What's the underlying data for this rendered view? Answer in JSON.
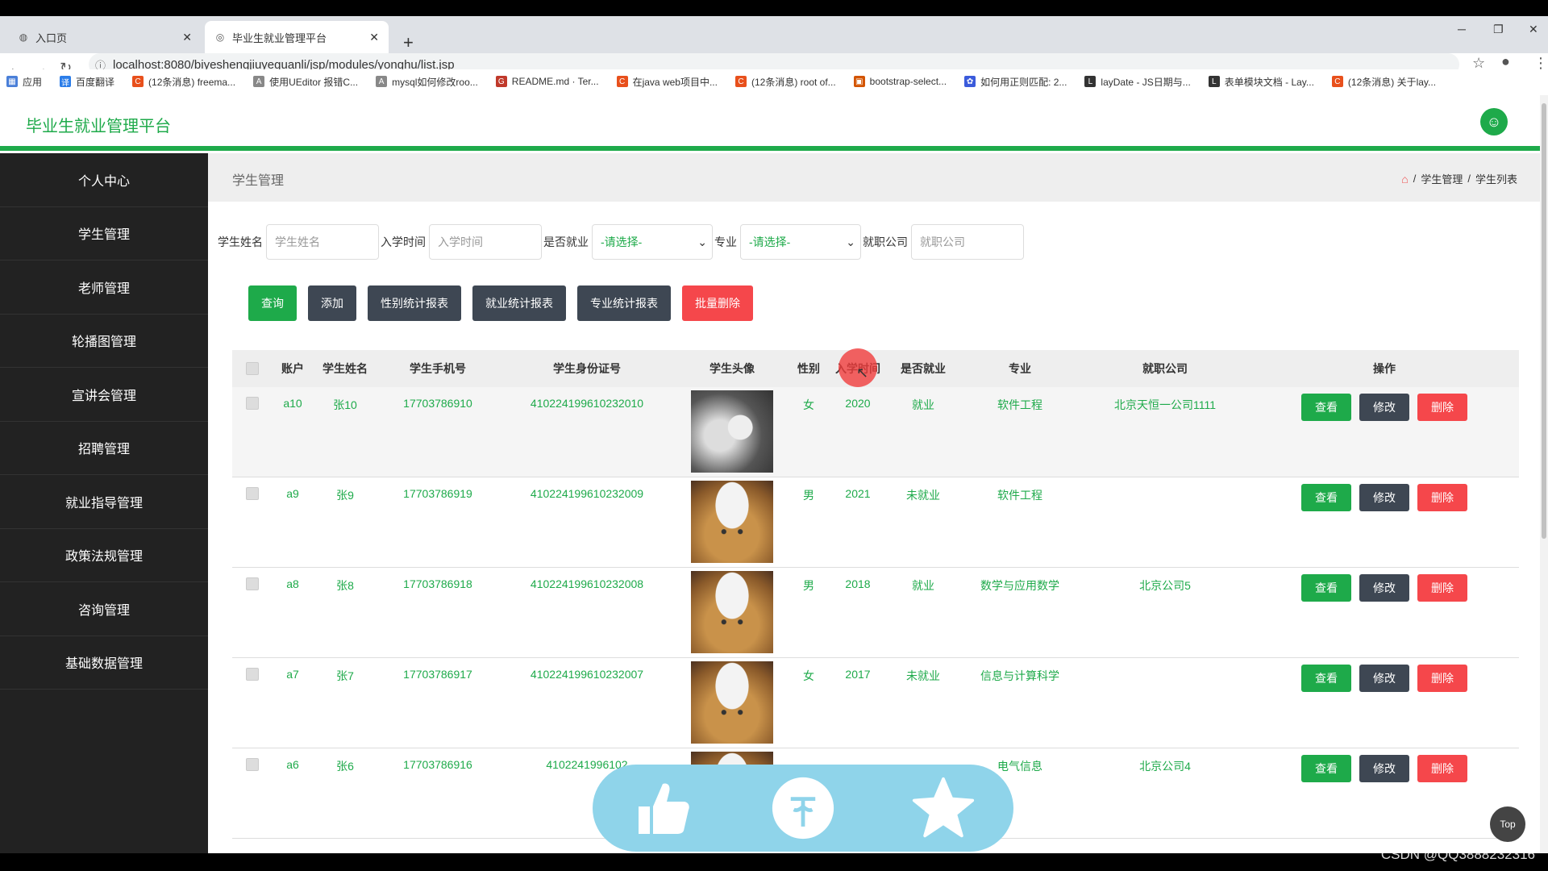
{
  "browser": {
    "tabs": [
      {
        "title": "入口页"
      },
      {
        "title": "毕业生就业管理平台"
      }
    ],
    "url": "localhost:8080/biyeshengjiuyeguanli/jsp/modules/yonghu/list.jsp",
    "bookmarks": [
      "应用",
      "百度翻译",
      "(12条消息) freema...",
      "使用UEditor 报错C...",
      "mysql如何修改roo...",
      "README.md · Ter...",
      "在java web项目中...",
      "(12条消息) root of...",
      "bootstrap-select...",
      "如何用正则匹配: 2...",
      "layDate - JS日期与...",
      "表单模块文档 - Lay...",
      "(12条消息) 关于lay..."
    ]
  },
  "app": {
    "title": "毕业生就业管理平台"
  },
  "sidebar": {
    "items": [
      "个人中心",
      "学生管理",
      "老师管理",
      "轮播图管理",
      "宣讲会管理",
      "招聘管理",
      "就业指导管理",
      "政策法规管理",
      "咨询管理",
      "基础数据管理"
    ]
  },
  "page": {
    "title": "学生管理",
    "breadcrumb": [
      "学生管理",
      "学生列表"
    ]
  },
  "search": {
    "name_label": "学生姓名",
    "name_placeholder": "学生姓名",
    "year_label": "入学时间",
    "year_placeholder": "入学时间",
    "employed_label": "是否就业",
    "employed_value": "-请选择-",
    "major_label": "专业",
    "major_value": "-请选择-",
    "company_label": "就职公司",
    "company_placeholder": "就职公司"
  },
  "toolbar": {
    "query": "查询",
    "add": "添加",
    "gender_report": "性别统计报表",
    "employment_report": "就业统计报表",
    "major_report": "专业统计报表",
    "batch_delete": "批量删除"
  },
  "table": {
    "headers": [
      "账户",
      "学生姓名",
      "学生手机号",
      "学生身份证号",
      "学生头像",
      "性别",
      "入学时间",
      "是否就业",
      "专业",
      "就职公司",
      "操作"
    ],
    "rows": [
      {
        "account": "a10",
        "name": "张10",
        "phone": "17703786910",
        "id_card": "410224199610232010",
        "avatar": "husky",
        "gender": "女",
        "year": "2020",
        "employed": "就业",
        "major": "软件工程",
        "company": "北京天恒一公司1111"
      },
      {
        "account": "a9",
        "name": "张9",
        "phone": "17703786919",
        "id_card": "410224199610232009",
        "avatar": "cat",
        "gender": "男",
        "year": "2021",
        "employed": "未就业",
        "major": "软件工程",
        "company": ""
      },
      {
        "account": "a8",
        "name": "张8",
        "phone": "17703786918",
        "id_card": "410224199610232008",
        "avatar": "cat",
        "gender": "男",
        "year": "2018",
        "employed": "就业",
        "major": "数学与应用数学",
        "company": "北京公司5"
      },
      {
        "account": "a7",
        "name": "张7",
        "phone": "17703786917",
        "id_card": "410224199610232007",
        "avatar": "cat",
        "gender": "女",
        "year": "2017",
        "employed": "未就业",
        "major": "信息与计算科学",
        "company": ""
      },
      {
        "account": "a6",
        "name": "张6",
        "phone": "17703786916",
        "id_card": "4102241996102",
        "avatar": "cat",
        "gender": "",
        "year": "",
        "employed": "",
        "major": "电气信息",
        "company": "北京公司4"
      }
    ],
    "actions": {
      "view": "查看",
      "edit": "修改",
      "delete": "删除"
    }
  },
  "widgets": {
    "top_button": "Top",
    "watermark": "CSDN @QQ3888232316"
  },
  "colors": {
    "accent": "#1eaa4a",
    "sidebar": "#222222",
    "danger": "#f5474b",
    "dark_button": "#3e4753"
  }
}
